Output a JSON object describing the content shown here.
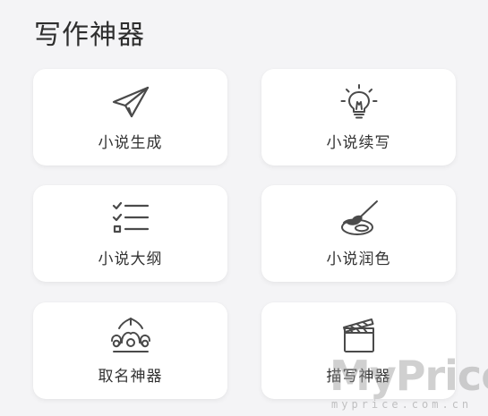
{
  "header": {
    "title": "写作神器"
  },
  "tools": [
    {
      "label": "小说生成",
      "icon": "paper-plane-icon"
    },
    {
      "label": "小说续写",
      "icon": "lightbulb-icon"
    },
    {
      "label": "小说大纲",
      "icon": "checklist-icon"
    },
    {
      "label": "小说润色",
      "icon": "paintbrush-palette-icon"
    },
    {
      "label": "取名神器",
      "icon": "crown-icon"
    },
    {
      "label": "描写神器",
      "icon": "clapperboard-icon"
    }
  ],
  "watermark": {
    "logo": "MyPrice",
    "url": "myprice.com.cn"
  },
  "colors": {
    "background": "#f4f4f6",
    "card": "#ffffff",
    "text": "#333333",
    "icon": "#4a4a4a"
  }
}
